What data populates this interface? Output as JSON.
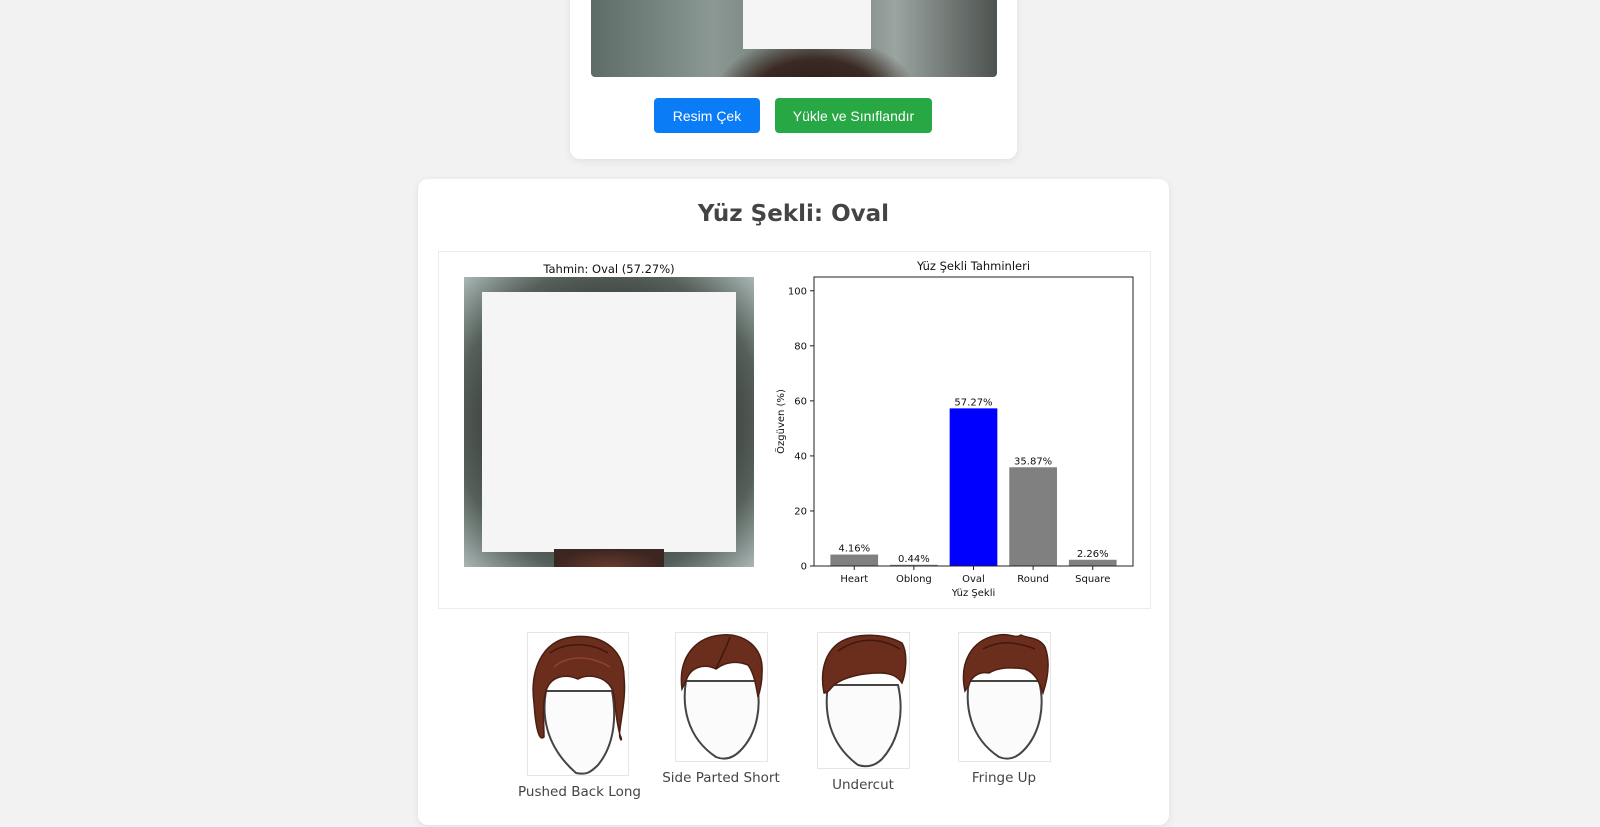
{
  "capture": {
    "capture_button": "Resim Çek",
    "upload_button": "Yükle ve Sınıflandır"
  },
  "result": {
    "title": "Yüz Şekli: Oval",
    "prediction_title": "Tahmin: Oval (57.27%)"
  },
  "chart_data": {
    "type": "bar",
    "title": "Yüz Şekli Tahminleri",
    "xlabel": "Yüz Şekli",
    "ylabel": "Özgüven (%)",
    "ylim": [
      0,
      105
    ],
    "yticks": [
      0,
      20,
      40,
      60,
      80,
      100
    ],
    "categories": [
      "Heart",
      "Oblong",
      "Oval",
      "Round",
      "Square"
    ],
    "values": [
      4.16,
      0.44,
      57.27,
      35.87,
      2.26
    ],
    "value_labels": [
      "4.16%",
      "0.44%",
      "57.27%",
      "35.87%",
      "2.26%"
    ],
    "bar_colors": [
      "#808080",
      "#808080",
      "#0000ff",
      "#808080",
      "#808080"
    ],
    "grid": false
  },
  "hairstyles": [
    {
      "label": "Pushed Back Long",
      "icon": "pushed-back-long-hair-icon"
    },
    {
      "label": "Side Parted Short",
      "icon": "side-parted-short-hair-icon"
    },
    {
      "label": "Undercut",
      "icon": "undercut-hair-icon"
    },
    {
      "label": "Fringe Up",
      "icon": "fringe-up-hair-icon"
    }
  ],
  "colors": {
    "primary": "#0a7cf5",
    "success": "#28a745",
    "hair": "#6b2e1c"
  }
}
